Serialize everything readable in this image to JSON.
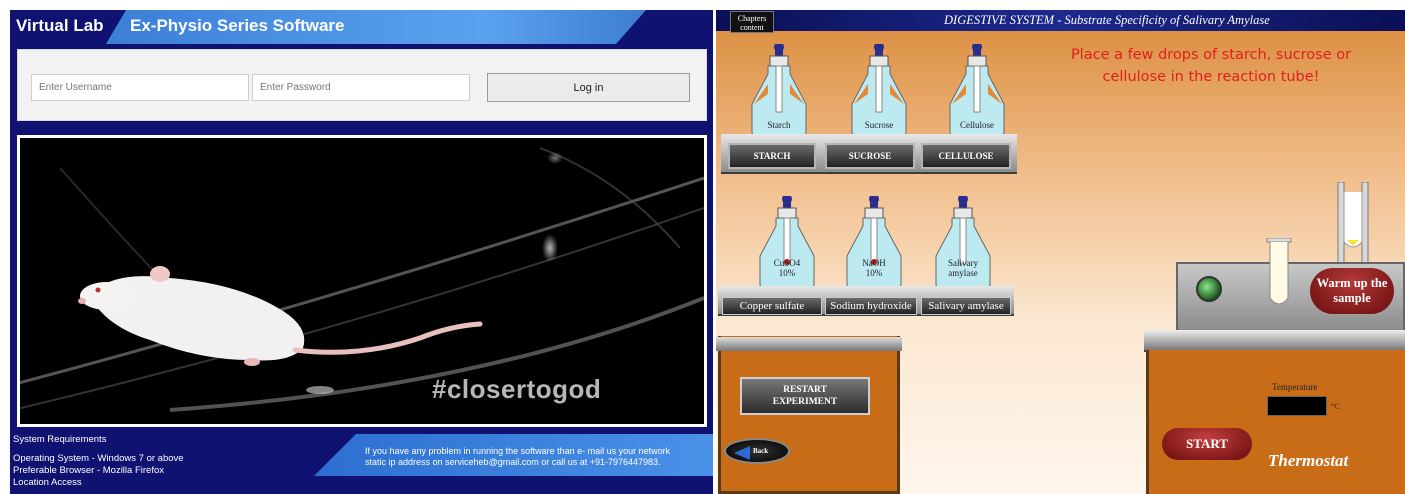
{
  "login_page": {
    "brand": "Virtual Lab",
    "series_title": "Ex-Physio Series Software",
    "username_placeholder": "Enter Username",
    "password_placeholder": "Enter Password",
    "login_button": "Log in",
    "photo_tag": "#closertogod",
    "requirements": {
      "heading": "System Requirements",
      "os": "Operating System - Windows 7 or above",
      "browser": "Preferable Browser - Mozilla Firefox",
      "location": "Location Access"
    },
    "contact_line1": "If you have any problem in running the software than e- mail us your network",
    "contact_line2": "static ip address on serviceheb@gmail.com or call us at +91-7976447983.",
    "colors": {
      "background": "#0f1270",
      "accent": "#4a91e8"
    }
  },
  "lab_page": {
    "chapters_button": "Chapters content",
    "title": "DIGESTIVE SYSTEM - Substrate Specificity of Salivary Amylase",
    "instruction_line1": "Place a few drops of starch, sucrose or",
    "instruction_line2": "cellulose in the reaction tube!",
    "substrate_bottles": [
      {
        "label": "Starch",
        "button": "STARCH"
      },
      {
        "label": "Sucrose",
        "button": "SUCROSE"
      },
      {
        "label": "Cellulose",
        "button": "CELLULOSE"
      }
    ],
    "reagent_bottles": [
      {
        "label_line1": "CuSO4",
        "label_line2": "10%",
        "button": "Copper sulfate"
      },
      {
        "label_line1": "NaOH",
        "label_line2": "10%",
        "button": "Sodium hydroxide"
      },
      {
        "label_line1": "Salivary",
        "label_line2": "amylase",
        "button": "Salivary amylase"
      }
    ],
    "restart_line1": "RESTART",
    "restart_line2": "EXPERIMENT",
    "back_button": "Back",
    "warm_line1": "Warm up the",
    "warm_line2": "sample",
    "temperature_label": "Temperature",
    "temperature_unit": "°C",
    "start_button": "START",
    "thermostat_label": "Thermostat",
    "colors": {
      "instruction": "#e0201e",
      "header": "#1d2a8e",
      "cabinet": "#c96c18"
    }
  }
}
